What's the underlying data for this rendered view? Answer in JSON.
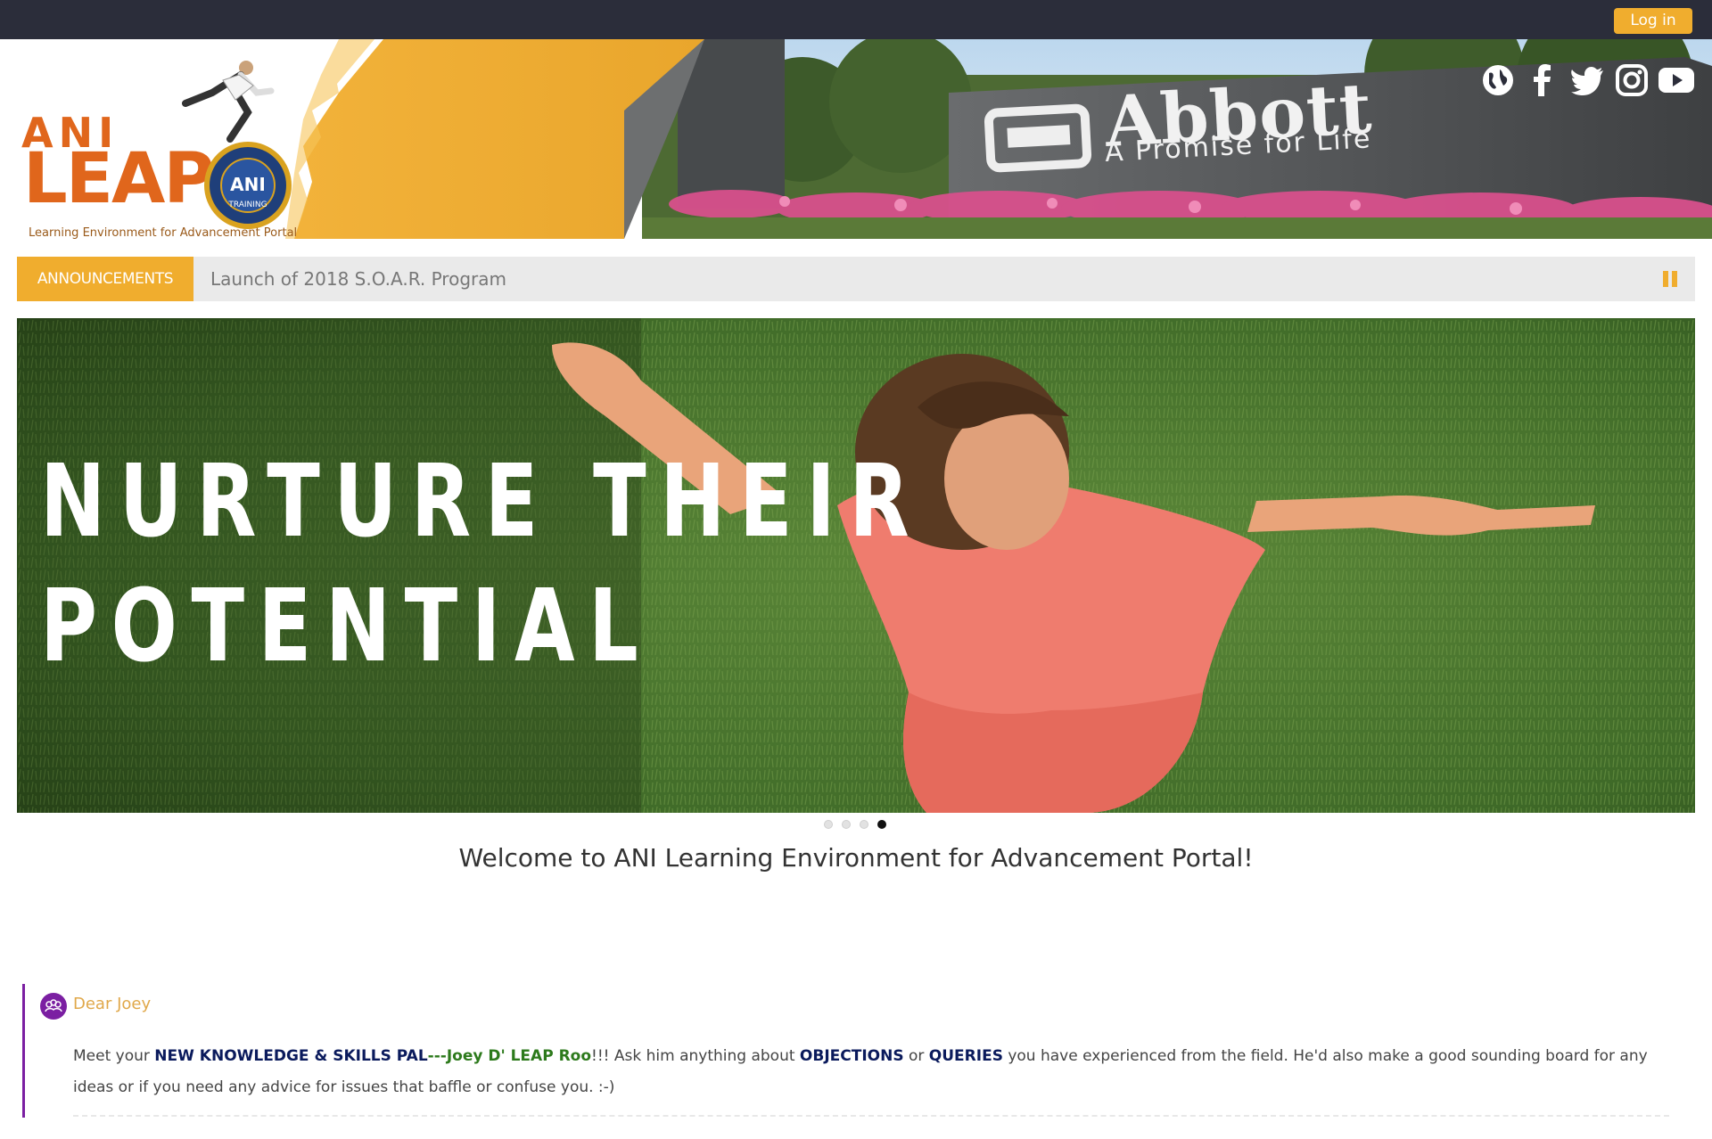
{
  "topbar": {
    "login_label": "Log in"
  },
  "header": {
    "logo": {
      "line1": "ANI",
      "line2": "LEAP",
      "seal_text": "TRAINING",
      "tagline": "Learning Environment for Advancement Portal"
    },
    "billboard": {
      "brand": "Abbott",
      "tagline": "A Promise for Life"
    },
    "social_icons": [
      "globe-icon",
      "facebook-icon",
      "twitter-icon",
      "instagram-icon",
      "youtube-icon"
    ]
  },
  "announcements": {
    "label": "ANNOUNCEMENTS",
    "text": "Launch of 2018 S.O.A.R. Program"
  },
  "hero": {
    "line1": "NURTURE THEIR",
    "line2": "POTENTIAL"
  },
  "carousel": {
    "slide_count": 4,
    "active_index": 4
  },
  "welcome": "Welcome to ANI Learning Environment for Advancement Portal!",
  "post": {
    "title": "Dear Joey",
    "body": {
      "p1": "Meet your ",
      "b1": "NEW KNOWLEDGE & SKILLS PAL",
      "g1": "---Joey D' LEAP Roo",
      "p2": "!!!  Ask him anything about ",
      "b2": "OBJECTIONS",
      "p3": " or ",
      "b3": "QUERIES",
      "p4": " you have experienced from the field.  He'd also make a good sounding board for any ideas or if you need any advice for issues that baffle or confuse you.  :-)"
    }
  },
  "colors": {
    "accent": "#f0ad2e",
    "topbar": "#2b2d3a",
    "post_border": "#7b1fa2",
    "logo_orange": "#e0661c"
  }
}
